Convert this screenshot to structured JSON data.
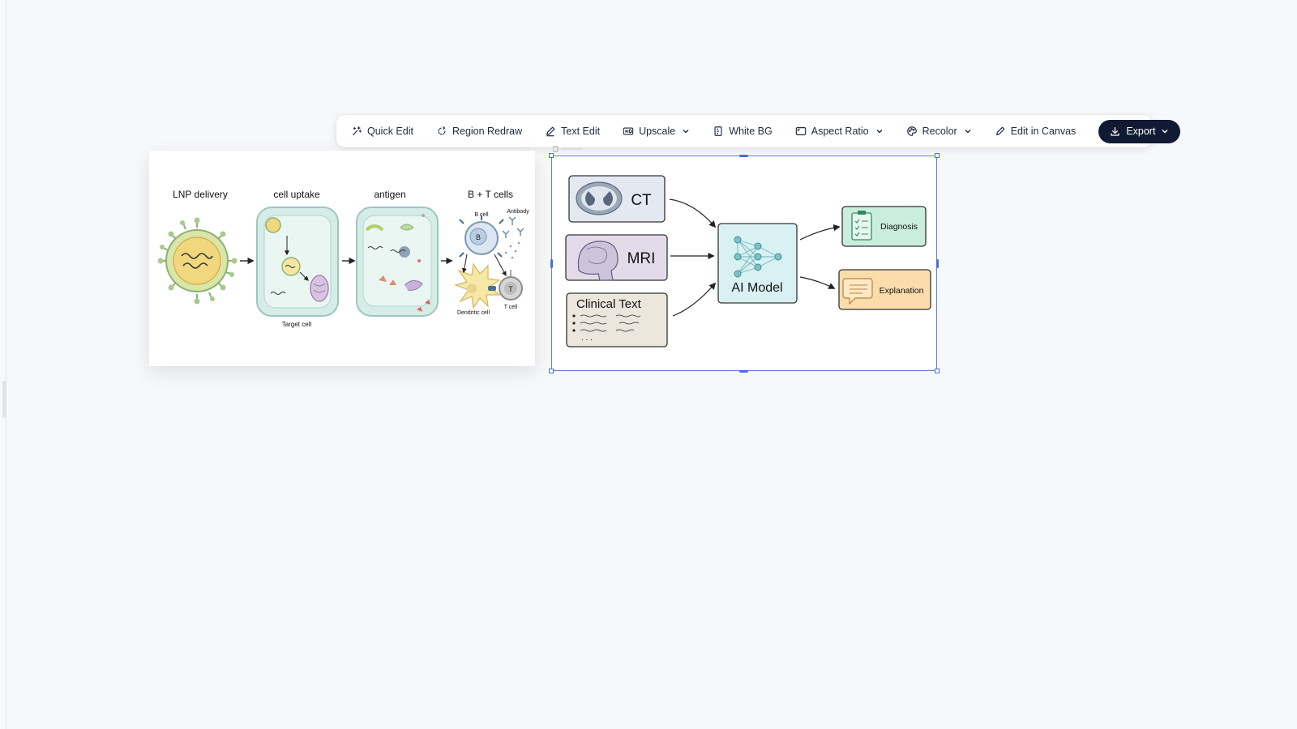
{
  "toolbar": {
    "quick_edit": "Quick Edit",
    "region_redraw": "Region Redraw",
    "text_edit": "Text Edit",
    "upscale": "Upscale",
    "white_bg": "White BG",
    "aspect_ratio": "Aspect Ratio",
    "recolor": "Recolor",
    "edit_in_canvas": "Edit in Canvas",
    "export": "Export"
  },
  "vaccine_figure": {
    "step1": "LNP delivery",
    "step2": "cell uptake",
    "step3": "antigen",
    "step4": "B + T cells",
    "target_cell": "Target cell",
    "b_cell": "B cell",
    "b_letter": "B",
    "antibody": "Antibody",
    "dendritic_cell": "Dendritic cell",
    "t_cell": "T cell",
    "t_letter": "T"
  },
  "ai_figure": {
    "ct": "CT",
    "mri": "MRI",
    "clinical_text": "Clinical Text",
    "ellipsis": ". . .",
    "ai_model": "AI Model",
    "diagnosis": "Diagnosis",
    "explanation": "Explanation"
  },
  "colors": {
    "accent": "#4a6fd0",
    "export_bg": "#101a33",
    "canvas_bg": "#f7f8fa"
  }
}
